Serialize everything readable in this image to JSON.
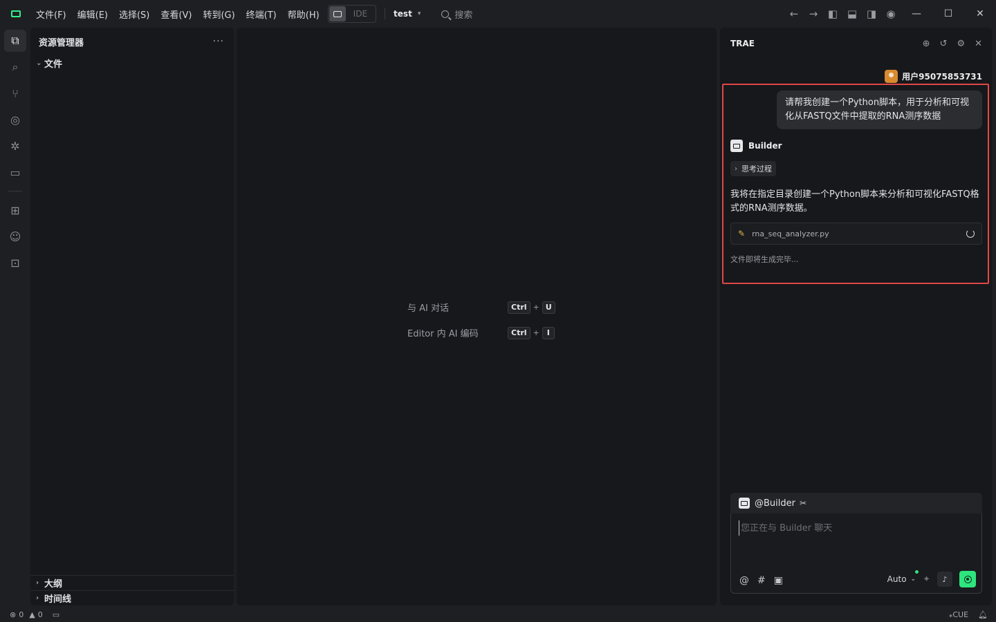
{
  "menu": [
    "文件(F)",
    "编辑(E)",
    "选择(S)",
    "查看(V)",
    "转到(G)",
    "终端(T)",
    "帮助(H)"
  ],
  "mode_toggle": {
    "label": "IDE"
  },
  "project": {
    "name": "test"
  },
  "search": {
    "label": "搜索"
  },
  "explorer": {
    "title": "资源管理器",
    "more": "···",
    "root": "文件",
    "outline": "大纲",
    "timeline": "时间线"
  },
  "editor": {
    "shortcuts": [
      {
        "label": "与 AI 对话",
        "keys": [
          "Ctrl",
          "U"
        ]
      },
      {
        "label": "Editor 内 AI 编码",
        "keys": [
          "Ctrl",
          "I"
        ]
      }
    ],
    "plus": "+"
  },
  "chat": {
    "title": "TRAE",
    "user_name": "用户95075853731",
    "user_message": "请帮我创建一个Python脚本，用于分析和可视化从FASTQ文件中提取的RNA测序数据",
    "bot_name": "Builder",
    "thinking_label": "思考过程",
    "bot_text": "我将在指定目录创建一个Python脚本来分析和可视化FASTQ格式的RNA测序数据。",
    "file_name": "rna_seq_analyzer.py",
    "file_status": "文件即将生成完毕...",
    "composer": {
      "agent_tag": "@Builder",
      "placeholder": "您正在与 Builder 聊天",
      "value": "",
      "model": "Auto"
    }
  },
  "status": {
    "errors": "0",
    "warnings": "0",
    "cue_label": "CUE"
  },
  "colors": {
    "accent": "#2ee47f",
    "highlight_border": "#e04848",
    "avatar": "#d88a2f"
  }
}
